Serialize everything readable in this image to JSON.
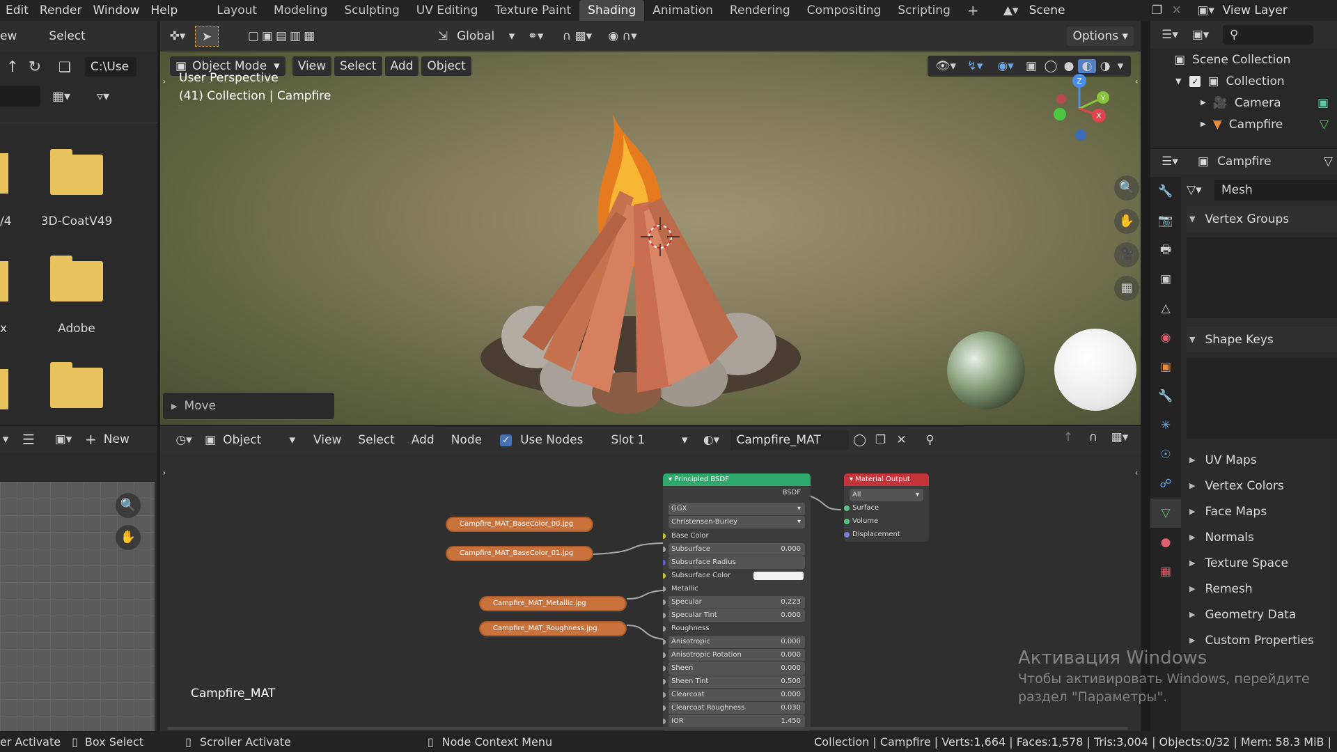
{
  "topbar": {
    "menus": [
      "Edit",
      "Render",
      "Window",
      "Help"
    ],
    "workspaces": [
      "Layout",
      "Modeling",
      "Sculpting",
      "UV Editing",
      "Texture Paint",
      "Shading",
      "Animation",
      "Rendering",
      "Compositing",
      "Scripting"
    ],
    "active_workspace": "Shading",
    "add_tab": "+",
    "scene_label": "Scene",
    "view_layer_label": "View Layer"
  },
  "filebrowser": {
    "header": {
      "view": "ew",
      "select": "Select"
    },
    "path": "C:\\Use",
    "folders": [
      {
        "label": "3D-CoatV49"
      },
      {
        "label": "Adobe"
      },
      {
        "label": ""
      }
    ],
    "left_partial_labels": [
      "/4",
      "x"
    ]
  },
  "viewport_header": {
    "transform": "Global",
    "options": "Options",
    "mode": "Object Mode",
    "menus": [
      "View",
      "Select",
      "Add",
      "Object"
    ]
  },
  "viewport": {
    "perspective": "User Perspective",
    "collection_info": "(41) Collection | Campfire",
    "operator_panel": "Move"
  },
  "image_editor": {
    "new_label": "New"
  },
  "node_header": {
    "type": "Object",
    "menus": [
      "View",
      "Select",
      "Add",
      "Node"
    ],
    "use_nodes": "Use Nodes",
    "slot": "Slot 1",
    "material": "Campfire_MAT"
  },
  "node_editor": {
    "material_label": "Campfire_MAT",
    "texture_nodes": [
      "Campfire_MAT_BaseColor_00.jpg",
      "Campfire_MAT_BaseColor_01.jpg",
      "Campfire_MAT_Metallic.jpg",
      "Campfire_MAT_Roughness.jpg"
    ],
    "bsdf": {
      "title": "Principled BSDF",
      "output": "BSDF",
      "distribution": "GGX",
      "subsurface_method": "Christensen-Burley",
      "rows": [
        {
          "label": "Base Color",
          "value": "",
          "field": false
        },
        {
          "label": "Subsurface",
          "value": "0.000",
          "field": true
        },
        {
          "label": "Subsurface Radius",
          "value": "",
          "field": true
        },
        {
          "label": "Subsurface Color",
          "value": "",
          "field": false
        },
        {
          "label": "Metallic",
          "value": "",
          "field": false
        },
        {
          "label": "Specular",
          "value": "0.223",
          "field": true
        },
        {
          "label": "Specular Tint",
          "value": "0.000",
          "field": true
        },
        {
          "label": "Roughness",
          "value": "",
          "field": false
        },
        {
          "label": "Anisotropic",
          "value": "0.000",
          "field": true
        },
        {
          "label": "Anisotropic Rotation",
          "value": "0.000",
          "field": true
        },
        {
          "label": "Sheen",
          "value": "0.000",
          "field": true
        },
        {
          "label": "Sheen Tint",
          "value": "0.500",
          "field": true
        },
        {
          "label": "Clearcoat",
          "value": "0.000",
          "field": true
        },
        {
          "label": "Clearcoat Roughness",
          "value": "0.030",
          "field": true
        },
        {
          "label": "IOR",
          "value": "1.450",
          "field": true
        }
      ]
    },
    "output_node": {
      "title": "Material Output",
      "target": "All",
      "sockets": [
        "Surface",
        "Volume",
        "Displacement"
      ]
    }
  },
  "outliner": {
    "items": [
      {
        "label": "Scene Collection"
      },
      {
        "label": "Collection"
      },
      {
        "label": "Camera"
      },
      {
        "label": "Campfire"
      }
    ]
  },
  "properties": {
    "object_name": "Campfire",
    "data_name": "Mesh",
    "sections": [
      "Vertex Groups",
      "Shape Keys",
      "UV Maps",
      "Vertex Colors",
      "Face Maps",
      "Normals",
      "Texture Space",
      "Remesh",
      "Geometry Data",
      "Custom Properties"
    ]
  },
  "watermark": {
    "line1": "Активация Windows",
    "line2": "Чтобы активировать Windows, перейдите",
    "line3": "раздел \"Параметры\"."
  },
  "statusbar": {
    "items": [
      "er Activate",
      "Box Select",
      "Scroller Activate",
      "Node Context Menu"
    ],
    "stats": "Collection | Campfire | Verts:1,664 | Faces:1,578 | Tris:3,004 | Objects:0/32 | Mem: 58.3 MiB |"
  }
}
